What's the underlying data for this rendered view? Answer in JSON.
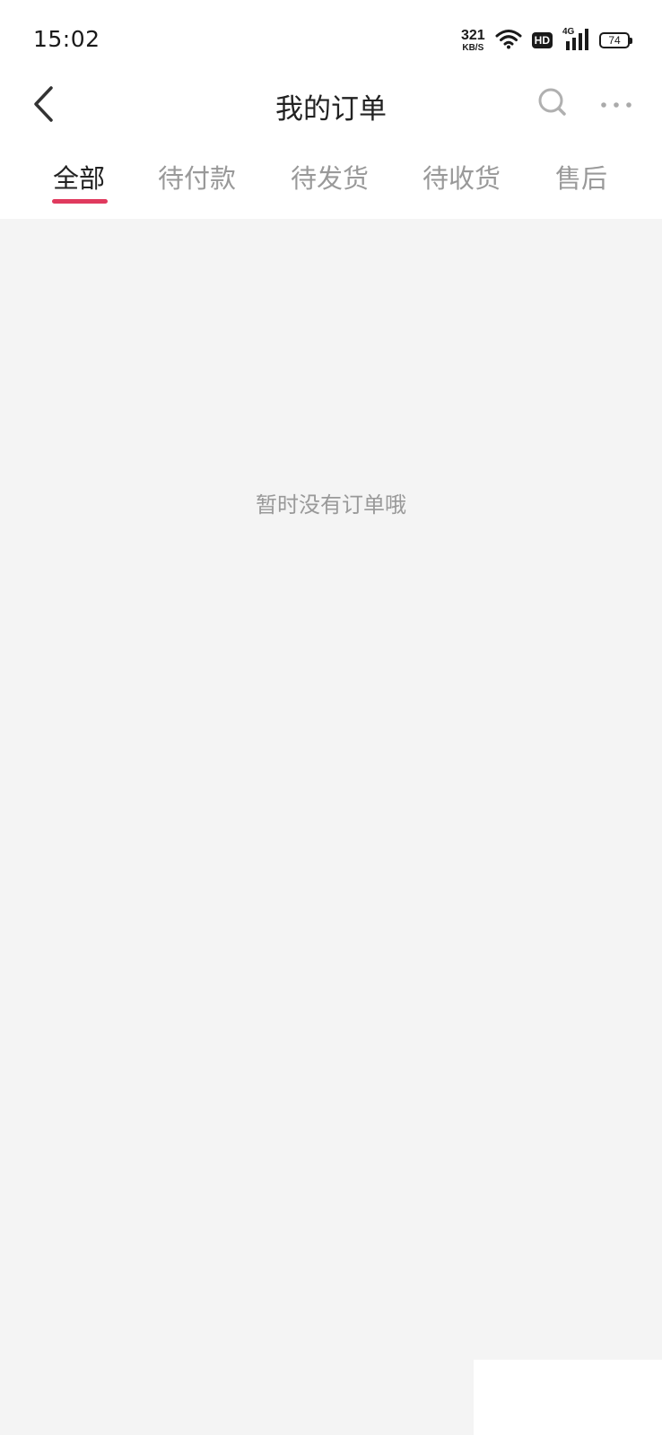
{
  "status_bar": {
    "time": "15:02",
    "net_speed_value": "321",
    "net_speed_unit": "KB/S",
    "hd_label": "HD",
    "network_type": "4G",
    "battery_level": "74",
    "icons": [
      "wifi-icon",
      "signal-icon",
      "battery-icon"
    ]
  },
  "header": {
    "title": "我的订单",
    "icons": [
      "back-chevron-icon",
      "search-icon",
      "more-dots-icon"
    ]
  },
  "tabs": [
    {
      "label": "全部",
      "active": true
    },
    {
      "label": "待付款",
      "active": false
    },
    {
      "label": "待发货",
      "active": false
    },
    {
      "label": "待收货",
      "active": false
    },
    {
      "label": "售后",
      "active": false
    }
  ],
  "content": {
    "empty_message": "暂时没有订单哦"
  },
  "colors": {
    "accent": "#e03a5e",
    "background": "#f4f4f4",
    "text_primary": "#222222",
    "text_secondary": "#999999"
  }
}
